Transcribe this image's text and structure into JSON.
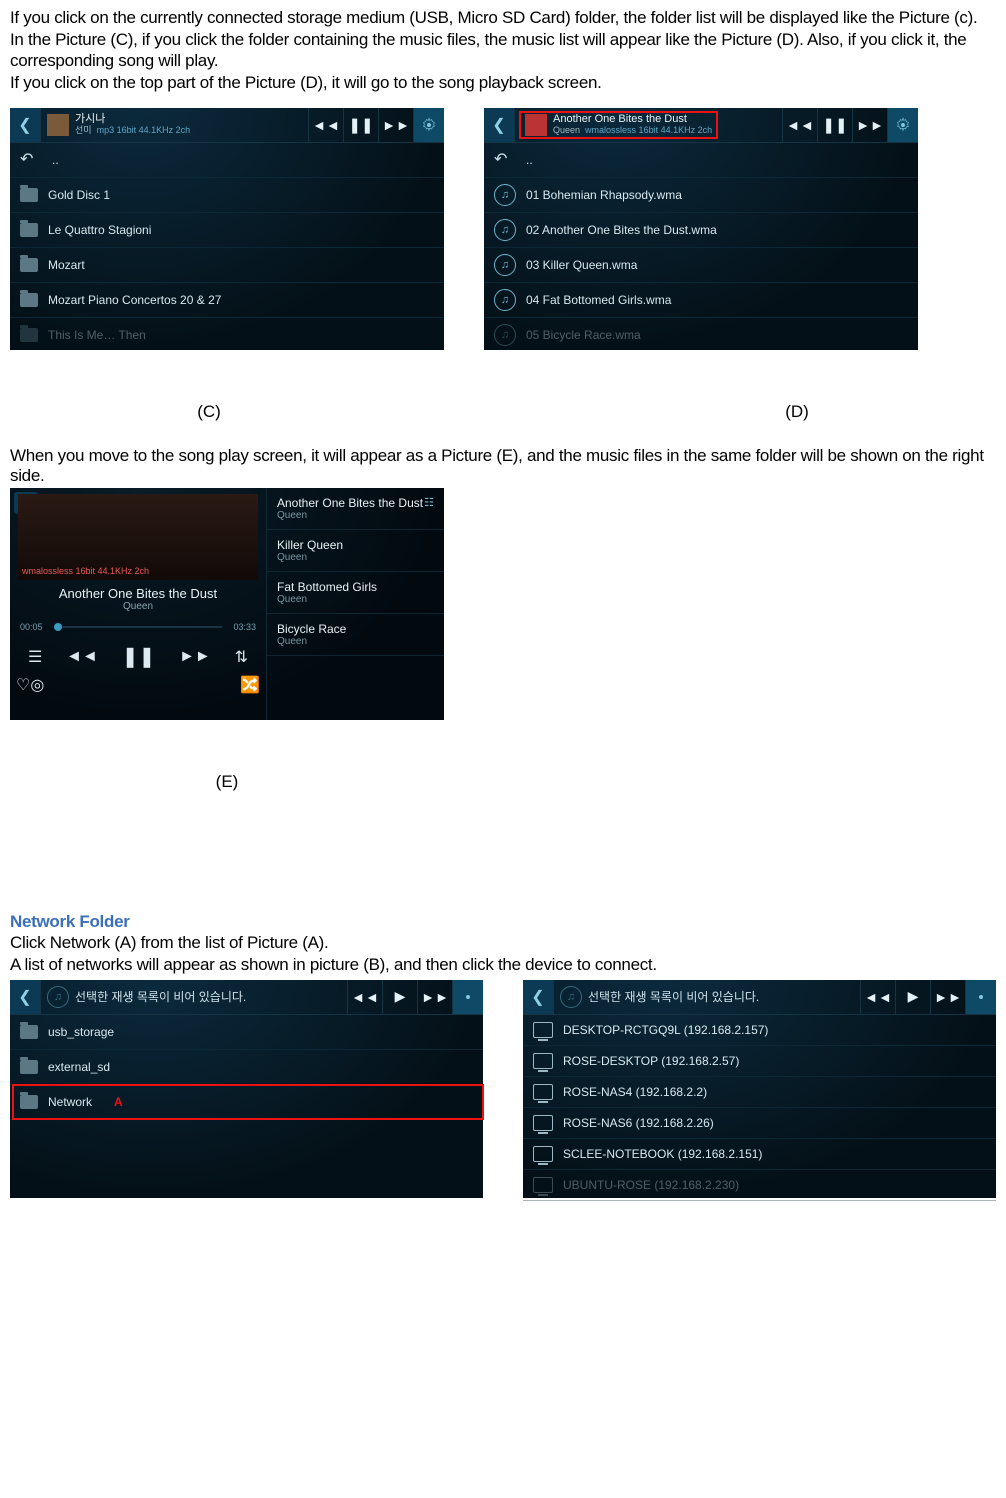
{
  "para1": "If you click on the currently connected storage medium (USB, Micro SD Card) folder, the folder list will be displayed like the Picture (c).",
  "para2": "In the Picture (C), if you click the folder containing the music files, the music list will appear like the Picture (D). Also, if you click it, the corresponding song will play.",
  "para3": "If you click on the top part of the Picture (D), it will go to the song playback screen.",
  "shotC": {
    "np_title": "가시나",
    "np_sub_artist": "선미",
    "np_sub_meta": "mp3 16bit 44.1KHz 2ch",
    "up": "..",
    "items": [
      "Gold Disc 1",
      "Le Quattro Stagioni",
      "Mozart",
      "Mozart Piano Concertos 20 & 27",
      "This Is Me… Then"
    ]
  },
  "shotD": {
    "np_title": "Another One Bites the Dust",
    "np_sub_artist": "Queen",
    "np_sub_meta": "wmalossless 16bit 44.1KHz 2ch",
    "up": "..",
    "items": [
      "01 Bohemian Rhapsody.wma",
      "02 Another One Bites the Dust.wma",
      "03 Killer Queen.wma",
      "04 Fat Bottomed Girls.wma",
      "05 Bicycle Race.wma"
    ]
  },
  "labelC": "(C)",
  "labelD": "(D)",
  "para4": "When you move to the song play screen, it will appear as a Picture (E), and the music files in the same folder will be shown on the right side.",
  "shotE": {
    "meta": "wmalossless 16bit 44.1KHz 2ch",
    "title": "Another One Bites the Dust",
    "artist": "Queen",
    "t_cur": "00:05",
    "t_tot": "03:33",
    "side": [
      {
        "t": "Another One Bites the Dust",
        "a": "Queen"
      },
      {
        "t": "Killer Queen",
        "a": "Queen"
      },
      {
        "t": "Fat Bottomed Girls",
        "a": "Queen"
      },
      {
        "t": "Bicycle Race",
        "a": "Queen"
      }
    ]
  },
  "labelE": "(E)",
  "heading2": "Network Folder",
  "para5": "Click Network (A) from the list of Picture (A).",
  "para6": "A list of networks will appear as shown in picture (B), and then click the device to connect.",
  "shotA": {
    "np_empty": "선택한 재생 목록이 비어 있습니다.",
    "items": [
      "usb_storage",
      "external_sd",
      "Network"
    ],
    "marker": "A"
  },
  "shotB": {
    "np_empty": "선택한 재생 목록이 비어 있습니다.",
    "items": [
      "DESKTOP-RCTGQ9L (192.168.2.157)",
      "ROSE-DESKTOP (192.168.2.57)",
      "ROSE-NAS4 (192.168.2.2)",
      "ROSE-NAS6 (192.168.2.26)",
      "SCLEE-NOTEBOOK (192.168.2.151)",
      "UBUNTU-ROSE (192.168.2.230)"
    ]
  }
}
